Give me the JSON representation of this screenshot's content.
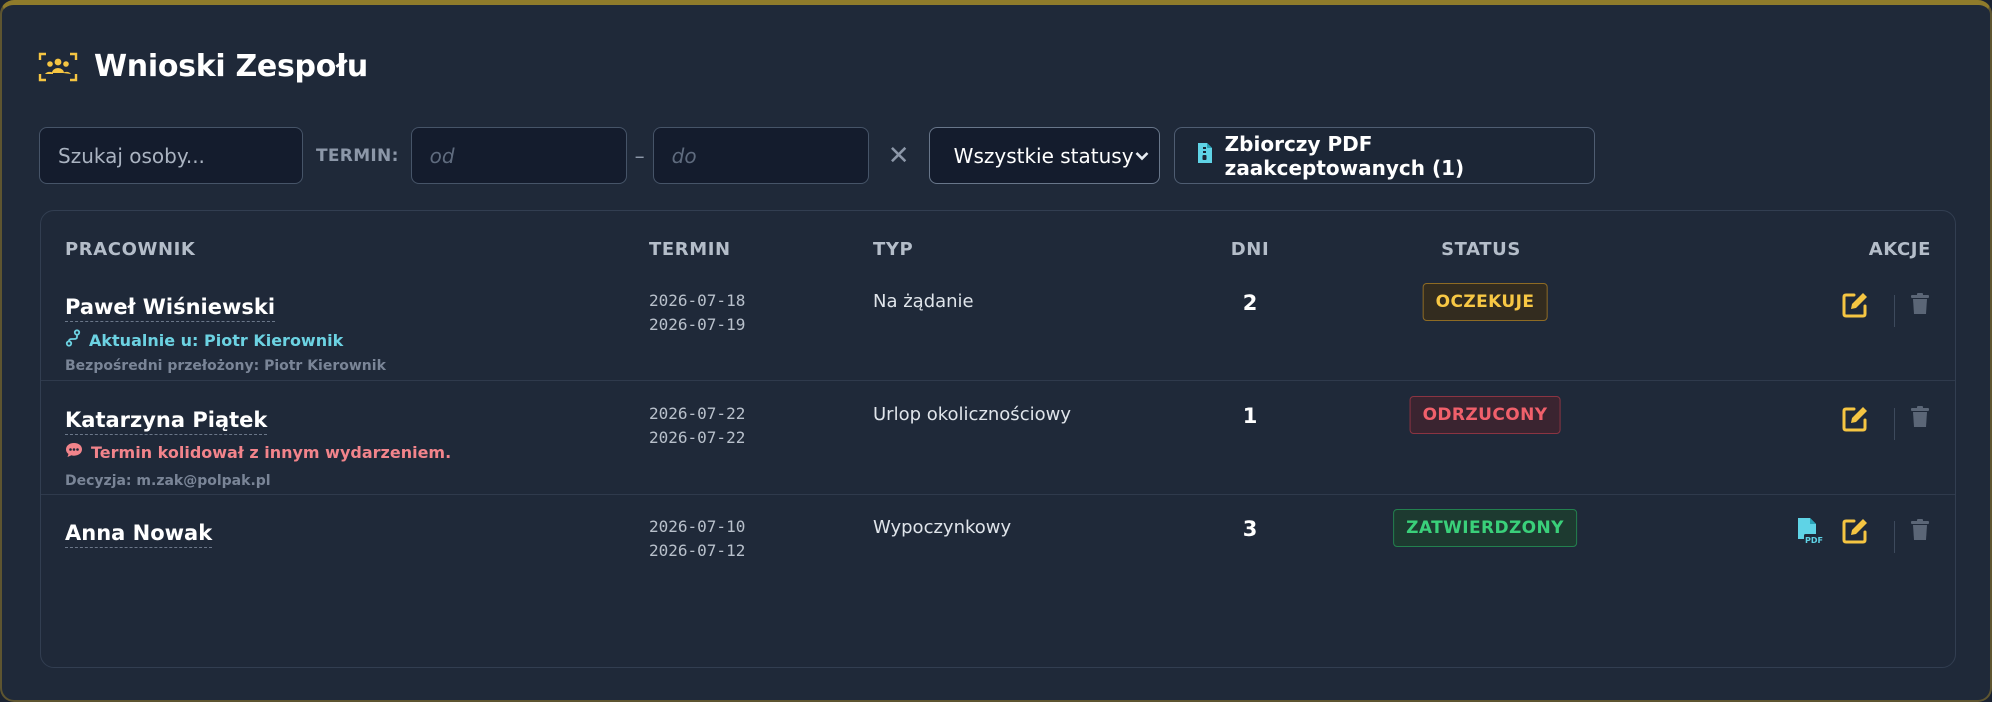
{
  "header": {
    "title": "Wnioski Zespołu",
    "icon": "team-icon"
  },
  "filters": {
    "search_placeholder": "Szukaj osoby...",
    "term_label": "TERMIN:",
    "from_placeholder": "od",
    "separator": "–",
    "to_placeholder": "do",
    "clear_symbol": "✕",
    "status_selected": "Wszystkie statusy",
    "pdf_button_label": "Zbiorczy PDF zaakceptowanych (1)"
  },
  "table": {
    "columns": {
      "employee": "PRACOWNIK",
      "term": "TERMIN",
      "type": "TYP",
      "days": "DNI",
      "status": "STATUS",
      "actions": "AKCJE"
    },
    "rows": [
      {
        "name": "Paweł Wiśniewski",
        "note": "Aktualnie u: Piotr Kierownik",
        "meta": "Bezpośredni przełożony: Piotr Kierownik",
        "date_from": "2026-07-18",
        "date_to": "2026-07-19",
        "type": "Na żądanie",
        "days": "2",
        "status": "OCZEKUJE"
      },
      {
        "name": "Katarzyna Piątek",
        "note": "Termin kolidował z innym wydarzeniem.",
        "meta": "Decyzja: m.zak@polpak.pl",
        "date_from": "2026-07-22",
        "date_to": "2026-07-22",
        "type": "Urlop okolicznościowy",
        "days": "1",
        "status": "ODRZUCONY"
      },
      {
        "name": "Anna Nowak",
        "date_from": "2026-07-10",
        "date_to": "2026-07-12",
        "type": "Wypoczynkowy",
        "days": "3",
        "status": "ZATWIERDZONY"
      }
    ]
  },
  "colors": {
    "accent": "#f5c542",
    "pending": "#f8c844",
    "rejected": "#f0606b",
    "approved": "#3ad07a",
    "pdf": "#5fd3e6"
  }
}
